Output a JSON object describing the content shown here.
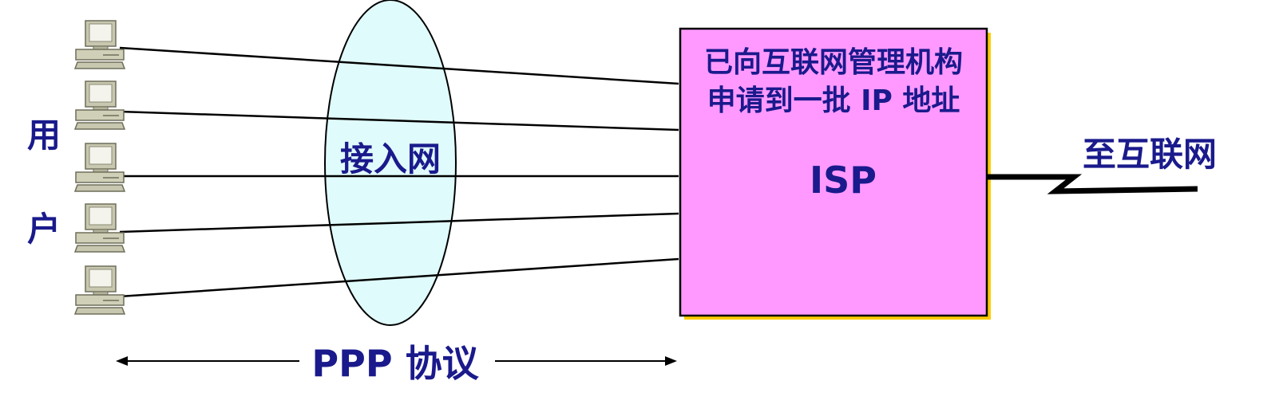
{
  "users_label_line1": "用",
  "users_label_line2": "户",
  "access_network_label": "接入网",
  "isp": {
    "note_line1": "已向互联网管理机构",
    "note_line2": "申请到一批 IP 地址",
    "name": "ISP"
  },
  "internet_label": "至互联网",
  "protocol_label": "PPP 协议",
  "computers": [
    "computer-1",
    "computer-2",
    "computer-3",
    "computer-4",
    "computer-5"
  ],
  "colors": {
    "text": "#1a1a8c",
    "isp_fill": "#ff99ff",
    "isp_shadow": "#ffcc00",
    "ellipse_fill": "#e0fbfb",
    "computer": "#c8c8b0"
  }
}
